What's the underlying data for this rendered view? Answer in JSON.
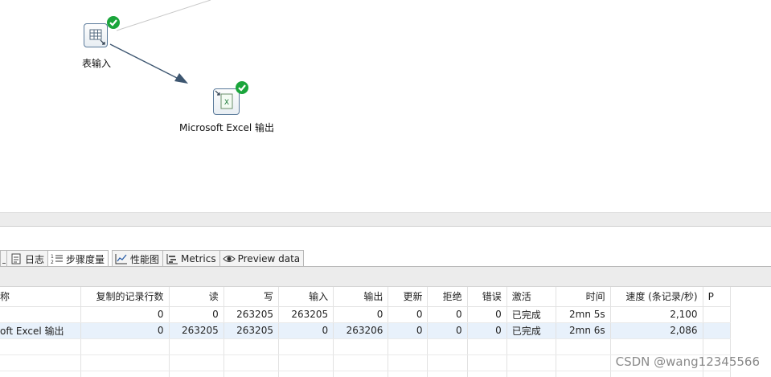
{
  "canvas": {
    "steps": [
      {
        "label": "表输入",
        "icon": "table-input-icon",
        "status": "check-icon"
      },
      {
        "label": "Microsoft Excel 输出",
        "icon": "excel-output-icon",
        "status": "check-icon"
      }
    ]
  },
  "tabs": [
    {
      "label": "日志",
      "icon": "log-icon"
    },
    {
      "label": "步骤度量",
      "icon": "step-metrics-icon"
    },
    {
      "label": "性能图",
      "icon": "performance-chart-icon"
    },
    {
      "label": "Metrics",
      "icon": "metrics-icon"
    },
    {
      "label": "Preview data",
      "icon": "eye-icon"
    }
  ],
  "table": {
    "columns": [
      "称",
      "复制的记录行数",
      "读",
      "写",
      "输入",
      "输出",
      "更新",
      "拒绝",
      "错误",
      "激活",
      "时间",
      "速度 (条记录/秒)",
      "P"
    ],
    "rows": [
      [
        "",
        "0",
        "0",
        "263205",
        "263205",
        "0",
        "0",
        "0",
        "0",
        "已完成",
        "2mn 5s",
        "2,100",
        ""
      ],
      [
        "oft Excel 输出",
        "0",
        "263205",
        "263205",
        "0",
        "263206",
        "0",
        "0",
        "0",
        "已完成",
        "2mn 6s",
        "2,086",
        ""
      ]
    ]
  },
  "watermark": "CSDN @wang12345566",
  "colors": {
    "check": "#1aa53b",
    "selected_row": "#e8f1fb",
    "hop": "#3d5670"
  }
}
